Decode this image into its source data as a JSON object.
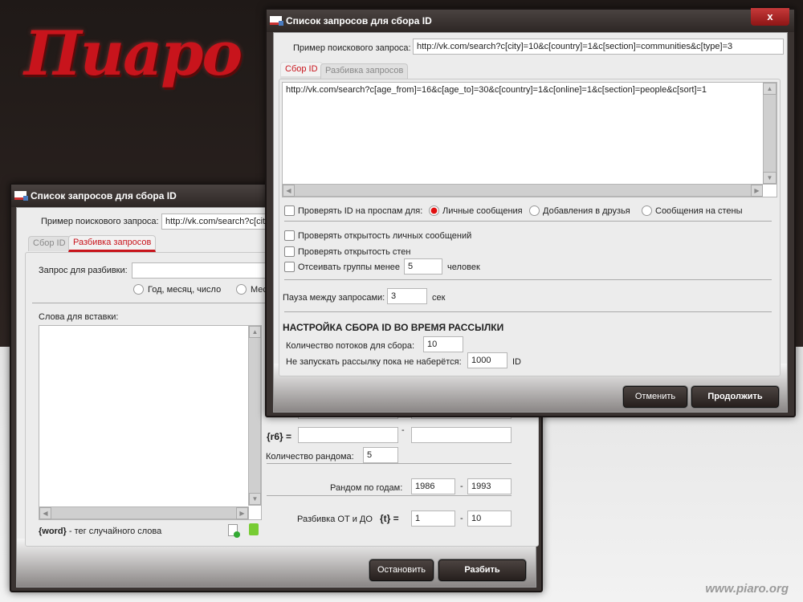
{
  "logo": "Пиаро",
  "watermark": "www.piaro.org",
  "back_window": {
    "title": "Список запросов для сбора ID",
    "sample_label": "Пример поискового запроса:",
    "sample_value": "http://vk.com/search?c[cit",
    "tabs": [
      "Сбор ID",
      "Разбивка запросов"
    ],
    "query_label": "Запрос для разбивки:",
    "query_value": "",
    "radio_1": "Год, месяц, число",
    "radio_2": "Меся",
    "words_label": "Слова для вставки:",
    "word_tag": "{word}",
    "word_tag_desc": " - тег случайного слова",
    "r6_label": "{r6} =",
    "r6_dash": "-",
    "r5_dash": "-",
    "random_count_label": "Количество рандома:",
    "random_count": "5",
    "years_label": "Рандом по годам:",
    "year_from": "1986",
    "year_to": "1993",
    "years_dash": "-",
    "split_label": "Разбивка ОТ и ДО",
    "split_tag": "{t} =",
    "split_from": "1",
    "split_to": "10",
    "split_dash": "-",
    "stop_button": "Остановить",
    "split_button": "Разбить"
  },
  "front_window": {
    "title": "Список запросов для сбора ID",
    "close": "x",
    "sample_label": "Пример поискового запроса:",
    "sample_value": "http://vk.com/search?c[city]=10&c[country]=1&c[section]=communities&c[type]=3",
    "tabs": [
      "Сбор ID",
      "Разбивка запросов"
    ],
    "urls": "http://vk.com/search?c[age_from]=16&c[age_to]=30&c[country]=1&c[online]=1&c[section]=people&c[sort]=1",
    "spam_check_label": "Проверять ID на проспам для:",
    "spam_options": [
      "Личные сообщения",
      "Добавления в друзья",
      "Сообщения на стены"
    ],
    "spam_selected": 0,
    "check_pm": "Проверять открытость личных сообщений",
    "check_walls": "Проверять открытость стен",
    "filter_groups": "Отсеивать группы менее",
    "filter_value": "5",
    "filter_unit": "человек",
    "pause_label": "Пауза между запросами:",
    "pause_value": "3",
    "pause_unit": "сек",
    "section_heading": "НАСТРОЙКА СБОРА ID ВО ВРЕМЯ РАССЫЛКИ",
    "threads_label": "Количество потоков для сбора:",
    "threads_value": "10",
    "min_ids_label": "Не запускать рассылку пока не наберётся:",
    "min_ids_value": "1000",
    "min_ids_unit": "ID",
    "cancel_button": "Отменить",
    "continue_button": "Продолжить"
  }
}
